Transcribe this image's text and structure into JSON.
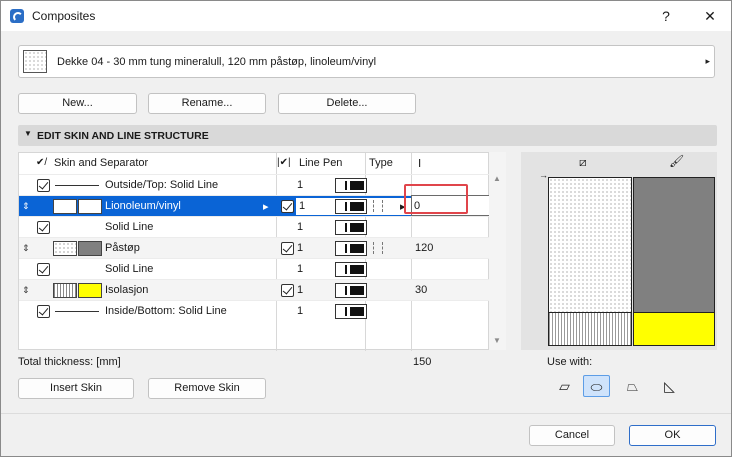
{
  "window": {
    "title": "Composites",
    "help_glyph": "?",
    "close_glyph": "✕"
  },
  "composite": {
    "name": "Dekke 04 - 30 mm tung mineralull, 120 mm påstøp, linoleum/vinyl",
    "arrow": "▸"
  },
  "buttons": {
    "new": "New...",
    "rename": "Rename...",
    "delete": "Delete...",
    "insert_skin": "Insert Skin",
    "remove_skin": "Remove Skin",
    "cancel": "Cancel",
    "ok": "OK"
  },
  "section": {
    "caret": "▼",
    "title": "EDIT SKIN AND LINE STRUCTURE"
  },
  "table": {
    "headers": {
      "skin": "Skin and Separator",
      "line_pen": "Line Pen",
      "type": "Type",
      "thickness_icon": "Ⅰ"
    },
    "rows": [
      {
        "kind": "separator",
        "label": "Outside/Top: Solid Line",
        "pen": "1"
      },
      {
        "kind": "skin",
        "label": "Lionoleum/vinyl",
        "pen": "1",
        "thickness": "0"
      },
      {
        "kind": "separator",
        "label": "Solid Line",
        "pen": "1"
      },
      {
        "kind": "skin",
        "label": "Påstøp",
        "pen": "1",
        "thickness": "120"
      },
      {
        "kind": "separator",
        "label": "Solid Line",
        "pen": "1"
      },
      {
        "kind": "skin",
        "label": "Isolasjon",
        "pen": "1",
        "thickness": "30"
      },
      {
        "kind": "separator",
        "label": "Inside/Bottom: Solid Line",
        "pen": "1"
      }
    ]
  },
  "totals": {
    "label": "Total thickness: [mm]",
    "value": "150"
  },
  "use_with": {
    "label": "Use with:"
  },
  "colors": {
    "selection": "#0a64d6",
    "highlight_border": "#e0454b",
    "fill_gray": "#808080",
    "fill_yellow": "#ffff00",
    "ok_border": "#2f6ec9"
  }
}
